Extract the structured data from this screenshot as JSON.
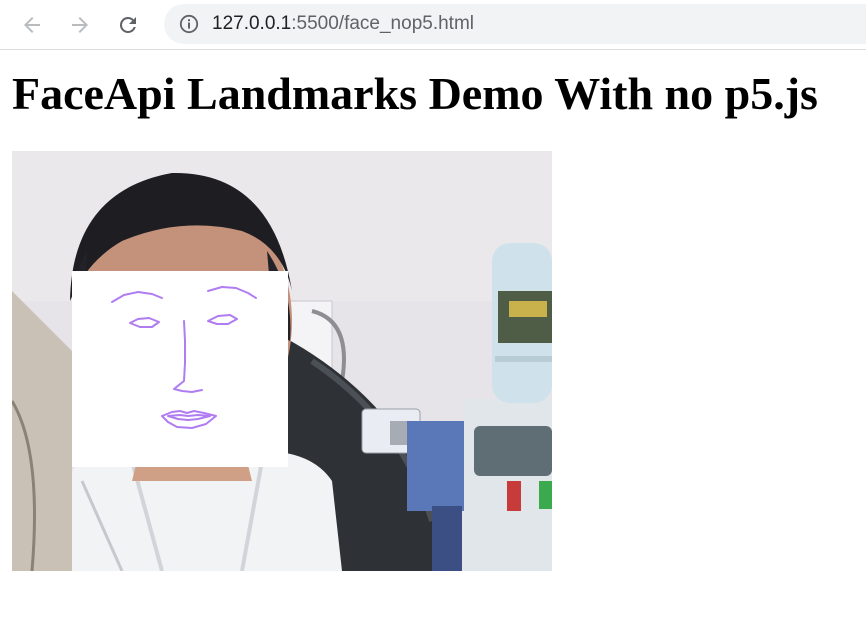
{
  "browser": {
    "url_host": "127.0.0.1",
    "url_rest": ":5500/face_nop5.html",
    "icons": {
      "back": "arrow-left-icon",
      "forward": "arrow-right-icon",
      "reload": "reload-icon",
      "site_info": "info-icon"
    }
  },
  "page": {
    "title": "FaceApi Landmarks Demo With no p5.js"
  },
  "colors": {
    "landmark_stroke": "#b07cf2",
    "canvas_bg": "#ffffff",
    "wall": "#e6e3e8"
  }
}
